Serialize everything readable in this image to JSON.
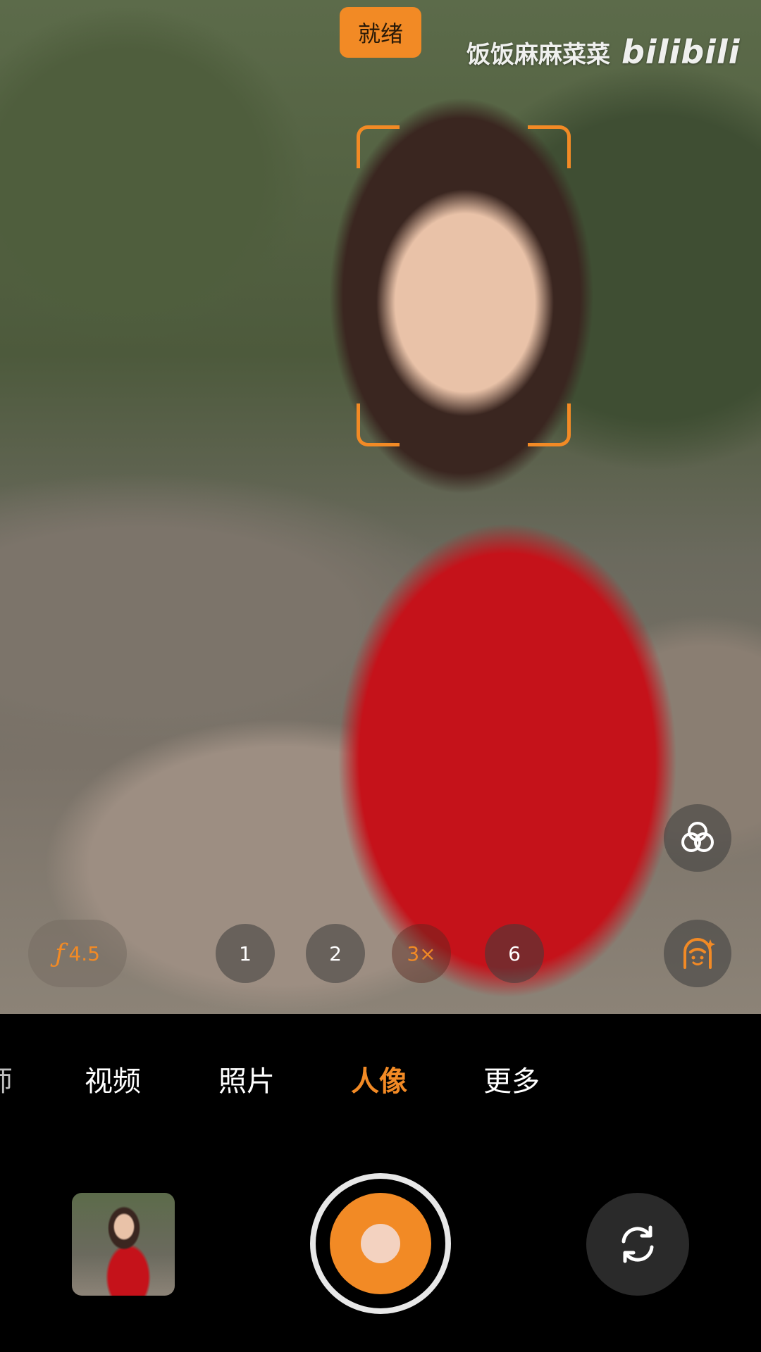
{
  "status": {
    "label": "就绪"
  },
  "watermark": {
    "channel": "饭饭麻麻菜菜",
    "logo_text": "bilibili"
  },
  "viewfinder": {
    "aperture": {
      "symbol": "ƒ",
      "value": "4.5"
    },
    "zoom_levels": [
      {
        "label": "1",
        "selected": false
      },
      {
        "label": "2",
        "selected": false
      },
      {
        "label": "3×",
        "selected": true
      },
      {
        "label": "6",
        "selected": false
      }
    ],
    "icons": [
      "filter-icon",
      "portrait-effect-icon"
    ]
  },
  "modes": {
    "partial_label": "师",
    "items": [
      {
        "label": "视频",
        "selected": false
      },
      {
        "label": "照片",
        "selected": false
      },
      {
        "label": "人像",
        "selected": true
      },
      {
        "label": "更多",
        "selected": false
      }
    ]
  },
  "controls": {
    "icons": [
      "gallery-thumbnail",
      "shutter-button",
      "switch-camera-icon"
    ]
  },
  "colors": {
    "accent": "#f28a25",
    "background": "#000000"
  }
}
